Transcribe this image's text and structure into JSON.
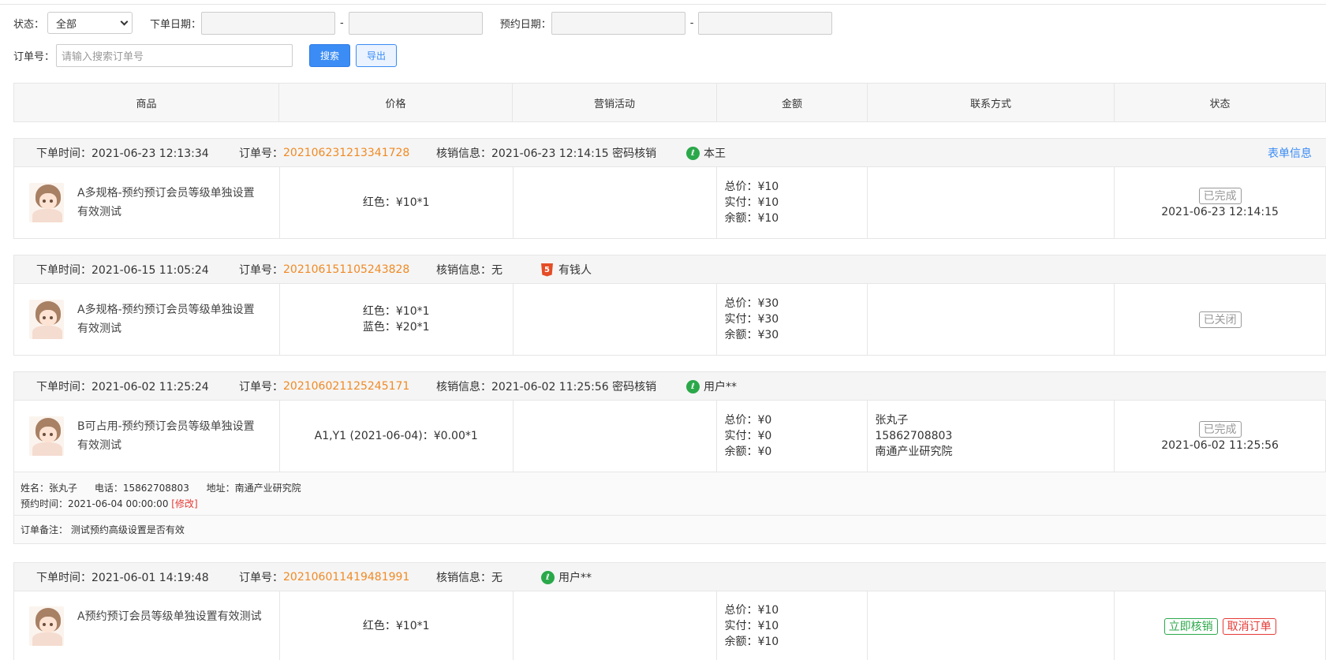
{
  "filters": {
    "status_label": "状态：",
    "status_value": "全部",
    "order_date_label": "下单日期：",
    "appointment_date_label": "预约日期：",
    "dash": "-",
    "order_no_label": "订单号：",
    "order_no_placeholder": "请输入搜索订单号",
    "search_button": "搜索",
    "export_button": "导出"
  },
  "table_header": [
    "商品",
    "价格",
    "营销活动",
    "金额",
    "联系方式",
    "状态"
  ],
  "orders": [
    {
      "time": "下单时间：2021-06-23 12:13:34",
      "order_no_label": "订单号：",
      "order_no": "202106231213341728",
      "verify": "核销信息：2021-06-23 12:14:15 密码核销",
      "user": "本王",
      "user_icon": "miniprogram-icon",
      "form_link": "表单信息",
      "product": "A多规格-预约预订会员等级单独设置有效测试",
      "prices": [
        "红色：¥10*1"
      ],
      "money": [
        "总价：¥10",
        "实付：¥10",
        "余额：¥10"
      ],
      "status_tag": "已完成",
      "status_date": "2021-06-23 12:14:15"
    },
    {
      "time": "下单时间：2021-06-15 11:05:24",
      "order_no_label": "订单号：",
      "order_no": "202106151105243828",
      "verify": "核销信息：无",
      "user": "有钱人",
      "user_icon": "html5-icon",
      "product": "A多规格-预约预订会员等级单独设置有效测试",
      "prices": [
        "红色：¥10*1",
        "蓝色：¥20*1"
      ],
      "money": [
        "总价：¥30",
        "实付：¥30",
        "余额：¥30"
      ],
      "status_tag": "已关闭"
    },
    {
      "time": "下单时间：2021-06-02 11:25:24",
      "order_no_label": "订单号：",
      "order_no": "202106021125245171",
      "verify": "核销信息：2021-06-02 11:25:56 密码核销",
      "user": "用户**",
      "user_icon": "miniprogram-icon",
      "product": "B可占用-预约预订会员等级单独设置有效测试",
      "prices": [
        "A1,Y1 (2021-06-04)：¥0.00*1"
      ],
      "money": [
        "总价：¥0",
        "实付：¥0",
        "余额：¥0"
      ],
      "contact": [
        "张丸子",
        "15862708803",
        "南通产业研究院"
      ],
      "status_tag": "已完成",
      "status_date": "2021-06-02 11:25:56",
      "extra": {
        "name": "姓名：张丸子",
        "phone": "电话：15862708803",
        "address": "地址：南通产业研究院",
        "appointment": "预约时间：2021-06-04 00:00:00",
        "modify": "[修改]",
        "remark": "订单备注： 测试预约高级设置是否有效"
      }
    },
    {
      "time": "下单时间：2021-06-01 14:19:48",
      "order_no_label": "订单号：",
      "order_no": "202106011419481991",
      "verify": "核销信息：无",
      "user": "用户**",
      "user_icon": "miniprogram-icon",
      "product": "A预约预订会员等级单独设置有效测试",
      "prices": [
        "红色：¥10*1"
      ],
      "money": [
        "总价：¥10",
        "实付：¥10",
        "余额：¥10"
      ],
      "actions": [
        "立即核销",
        "取消订单"
      ]
    }
  ],
  "colors": {
    "order_no": "#f08a24",
    "link": "#3b8cf5",
    "primary_button": "#3b8cf5",
    "success": "#2ba84a",
    "danger": "#e53935"
  }
}
